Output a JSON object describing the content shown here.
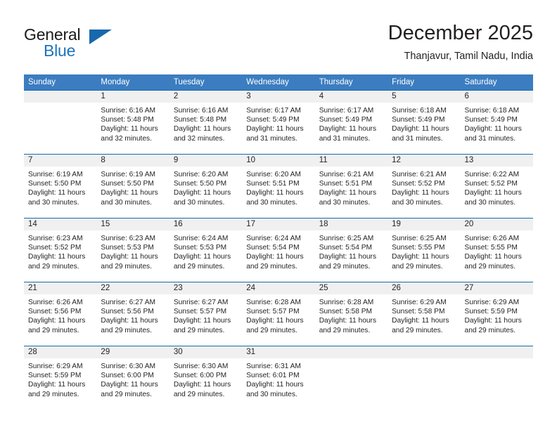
{
  "branding": {
    "logo_text_primary": "General",
    "logo_text_secondary": "Blue",
    "logo_triangle_color": "#1768ad",
    "logo_blue_color": "#1e72bb"
  },
  "header": {
    "title": "December 2025",
    "subtitle": "Thanjavur, Tamil Nadu, India"
  },
  "colors": {
    "header_row_bg": "#3b7dc0",
    "row_divider": "#1768ad",
    "daynum_bg": "#f0f0f0",
    "text": "#231f20"
  },
  "weekdays": [
    "Sunday",
    "Monday",
    "Tuesday",
    "Wednesday",
    "Thursday",
    "Friday",
    "Saturday"
  ],
  "weeks": [
    [
      {
        "day": "",
        "sunrise": "",
        "sunset": "",
        "daylight": "",
        "empty": true
      },
      {
        "day": "1",
        "sunrise": "Sunrise: 6:16 AM",
        "sunset": "Sunset: 5:48 PM",
        "daylight": "Daylight: 11 hours and 32 minutes."
      },
      {
        "day": "2",
        "sunrise": "Sunrise: 6:16 AM",
        "sunset": "Sunset: 5:48 PM",
        "daylight": "Daylight: 11 hours and 32 minutes."
      },
      {
        "day": "3",
        "sunrise": "Sunrise: 6:17 AM",
        "sunset": "Sunset: 5:49 PM",
        "daylight": "Daylight: 11 hours and 31 minutes."
      },
      {
        "day": "4",
        "sunrise": "Sunrise: 6:17 AM",
        "sunset": "Sunset: 5:49 PM",
        "daylight": "Daylight: 11 hours and 31 minutes."
      },
      {
        "day": "5",
        "sunrise": "Sunrise: 6:18 AM",
        "sunset": "Sunset: 5:49 PM",
        "daylight": "Daylight: 11 hours and 31 minutes."
      },
      {
        "day": "6",
        "sunrise": "Sunrise: 6:18 AM",
        "sunset": "Sunset: 5:49 PM",
        "daylight": "Daylight: 11 hours and 31 minutes."
      }
    ],
    [
      {
        "day": "7",
        "sunrise": "Sunrise: 6:19 AM",
        "sunset": "Sunset: 5:50 PM",
        "daylight": "Daylight: 11 hours and 30 minutes."
      },
      {
        "day": "8",
        "sunrise": "Sunrise: 6:19 AM",
        "sunset": "Sunset: 5:50 PM",
        "daylight": "Daylight: 11 hours and 30 minutes."
      },
      {
        "day": "9",
        "sunrise": "Sunrise: 6:20 AM",
        "sunset": "Sunset: 5:50 PM",
        "daylight": "Daylight: 11 hours and 30 minutes."
      },
      {
        "day": "10",
        "sunrise": "Sunrise: 6:20 AM",
        "sunset": "Sunset: 5:51 PM",
        "daylight": "Daylight: 11 hours and 30 minutes."
      },
      {
        "day": "11",
        "sunrise": "Sunrise: 6:21 AM",
        "sunset": "Sunset: 5:51 PM",
        "daylight": "Daylight: 11 hours and 30 minutes."
      },
      {
        "day": "12",
        "sunrise": "Sunrise: 6:21 AM",
        "sunset": "Sunset: 5:52 PM",
        "daylight": "Daylight: 11 hours and 30 minutes."
      },
      {
        "day": "13",
        "sunrise": "Sunrise: 6:22 AM",
        "sunset": "Sunset: 5:52 PM",
        "daylight": "Daylight: 11 hours and 30 minutes."
      }
    ],
    [
      {
        "day": "14",
        "sunrise": "Sunrise: 6:23 AM",
        "sunset": "Sunset: 5:52 PM",
        "daylight": "Daylight: 11 hours and 29 minutes."
      },
      {
        "day": "15",
        "sunrise": "Sunrise: 6:23 AM",
        "sunset": "Sunset: 5:53 PM",
        "daylight": "Daylight: 11 hours and 29 minutes."
      },
      {
        "day": "16",
        "sunrise": "Sunrise: 6:24 AM",
        "sunset": "Sunset: 5:53 PM",
        "daylight": "Daylight: 11 hours and 29 minutes."
      },
      {
        "day": "17",
        "sunrise": "Sunrise: 6:24 AM",
        "sunset": "Sunset: 5:54 PM",
        "daylight": "Daylight: 11 hours and 29 minutes."
      },
      {
        "day": "18",
        "sunrise": "Sunrise: 6:25 AM",
        "sunset": "Sunset: 5:54 PM",
        "daylight": "Daylight: 11 hours and 29 minutes."
      },
      {
        "day": "19",
        "sunrise": "Sunrise: 6:25 AM",
        "sunset": "Sunset: 5:55 PM",
        "daylight": "Daylight: 11 hours and 29 minutes."
      },
      {
        "day": "20",
        "sunrise": "Sunrise: 6:26 AM",
        "sunset": "Sunset: 5:55 PM",
        "daylight": "Daylight: 11 hours and 29 minutes."
      }
    ],
    [
      {
        "day": "21",
        "sunrise": "Sunrise: 6:26 AM",
        "sunset": "Sunset: 5:56 PM",
        "daylight": "Daylight: 11 hours and 29 minutes."
      },
      {
        "day": "22",
        "sunrise": "Sunrise: 6:27 AM",
        "sunset": "Sunset: 5:56 PM",
        "daylight": "Daylight: 11 hours and 29 minutes."
      },
      {
        "day": "23",
        "sunrise": "Sunrise: 6:27 AM",
        "sunset": "Sunset: 5:57 PM",
        "daylight": "Daylight: 11 hours and 29 minutes."
      },
      {
        "day": "24",
        "sunrise": "Sunrise: 6:28 AM",
        "sunset": "Sunset: 5:57 PM",
        "daylight": "Daylight: 11 hours and 29 minutes."
      },
      {
        "day": "25",
        "sunrise": "Sunrise: 6:28 AM",
        "sunset": "Sunset: 5:58 PM",
        "daylight": "Daylight: 11 hours and 29 minutes."
      },
      {
        "day": "26",
        "sunrise": "Sunrise: 6:29 AM",
        "sunset": "Sunset: 5:58 PM",
        "daylight": "Daylight: 11 hours and 29 minutes."
      },
      {
        "day": "27",
        "sunrise": "Sunrise: 6:29 AM",
        "sunset": "Sunset: 5:59 PM",
        "daylight": "Daylight: 11 hours and 29 minutes."
      }
    ],
    [
      {
        "day": "28",
        "sunrise": "Sunrise: 6:29 AM",
        "sunset": "Sunset: 5:59 PM",
        "daylight": "Daylight: 11 hours and 29 minutes."
      },
      {
        "day": "29",
        "sunrise": "Sunrise: 6:30 AM",
        "sunset": "Sunset: 6:00 PM",
        "daylight": "Daylight: 11 hours and 29 minutes."
      },
      {
        "day": "30",
        "sunrise": "Sunrise: 6:30 AM",
        "sunset": "Sunset: 6:00 PM",
        "daylight": "Daylight: 11 hours and 29 minutes."
      },
      {
        "day": "31",
        "sunrise": "Sunrise: 6:31 AM",
        "sunset": "Sunset: 6:01 PM",
        "daylight": "Daylight: 11 hours and 30 minutes."
      },
      {
        "day": "",
        "sunrise": "",
        "sunset": "",
        "daylight": "",
        "empty": true
      },
      {
        "day": "",
        "sunrise": "",
        "sunset": "",
        "daylight": "",
        "empty": true
      },
      {
        "day": "",
        "sunrise": "",
        "sunset": "",
        "daylight": "",
        "empty": true
      }
    ]
  ]
}
